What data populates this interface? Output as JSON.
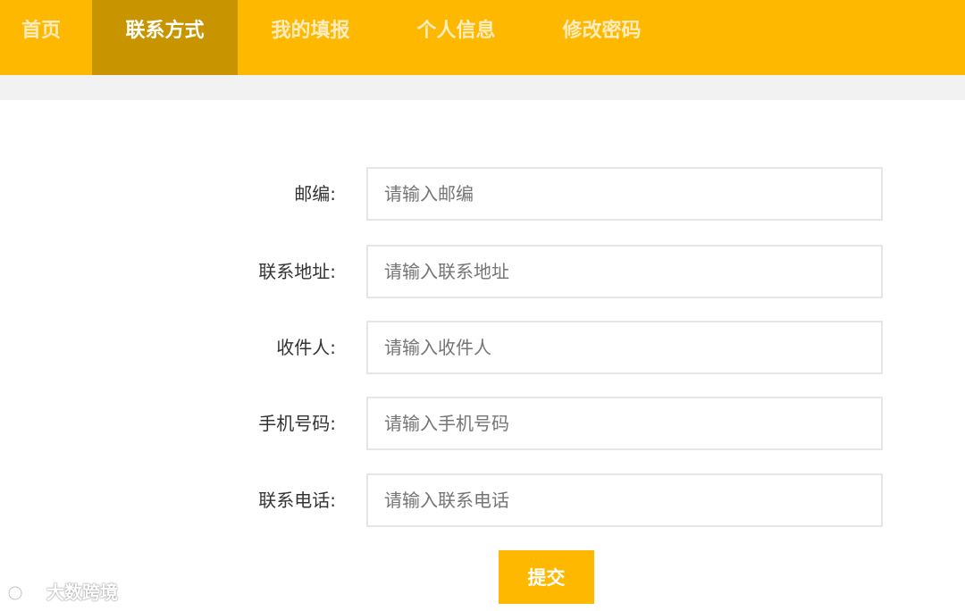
{
  "nav": {
    "items": [
      {
        "label": "首页"
      },
      {
        "label": "联系方式"
      },
      {
        "label": "我的填报"
      },
      {
        "label": "个人信息"
      },
      {
        "label": "修改密码"
      }
    ]
  },
  "form": {
    "fields": [
      {
        "label": "邮编:",
        "placeholder": "请输入邮编"
      },
      {
        "label": "联系地址:",
        "placeholder": "请输入联系地址"
      },
      {
        "label": "收件人:",
        "placeholder": "请输入收件人"
      },
      {
        "label": "手机号码:",
        "placeholder": "请输入手机号码"
      },
      {
        "label": "联系电话:",
        "placeholder": "请输入联系电话"
      }
    ],
    "submit_label": "提交"
  },
  "watermark": {
    "text": "大数跨境"
  },
  "colors": {
    "accent": "#ffb800",
    "accent_active": "#c89400"
  }
}
